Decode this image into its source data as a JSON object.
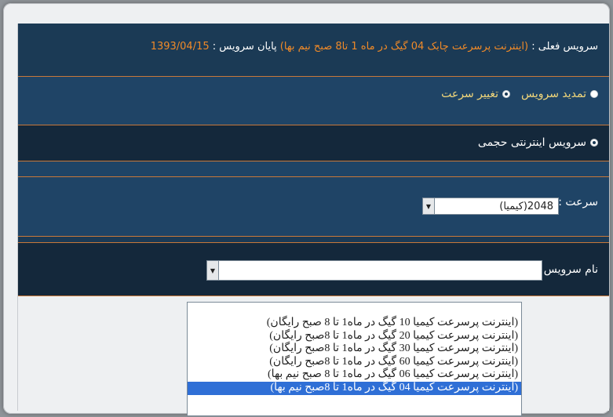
{
  "current_service": {
    "prefix": "سرویس فعلی :",
    "name": "(اینترنت پرسرعت چابک 04 گیگ در ماه 1 تا8 صبح نیم بها)",
    "end_label": "پایان سرویس :",
    "end_date": "1393/04/15"
  },
  "radio_options": {
    "extend": "تمدید سرویس",
    "change_speed": "تغییر سرعت",
    "volume_service": "سرویس اینترنتی حجمی"
  },
  "speed": {
    "label": "سرعت :",
    "value": "2048(کیمیا)"
  },
  "service_name": {
    "label": "نام سرویس :",
    "value": "",
    "options": [
      "",
      "(اینترنت پرسرعت کیمیا 10 گیگ در ماه1 تا 8 صبح رایگان)",
      "(اینترنت پرسرعت کیمیا 20 گیگ در ماه1 تا 8صبح رایگان)",
      "(اینترنت پرسرعت کیمیا 30 گیگ در ماه1 تا 8صبح رایگان)",
      "(اینترنت پرسرعت کیمیا 60 گیگ در ماه1 تا 8صبح رایگان)",
      "(اینترنت پرسرعت کیمیا 06 گیگ در ماه1 تا 8 صبح نیم بها)",
      "(اینترنت پرسرعت کیمیا 04 گیگ در ماه1 تا 8صبح نیم بها)"
    ],
    "selected_index": 6
  },
  "icons": {
    "select_arrow": "chevron-down-icon"
  }
}
